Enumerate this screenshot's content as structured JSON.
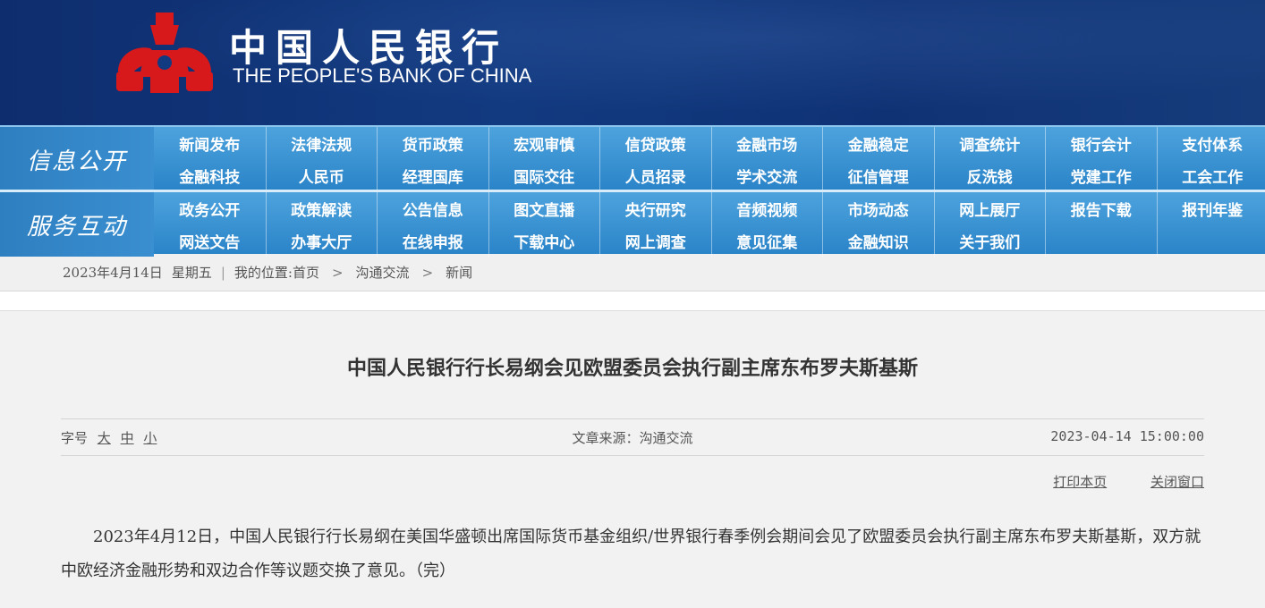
{
  "header": {
    "logo_cn": "中国人民银行",
    "logo_en": "THE PEOPLE'S BANK OF CHINA",
    "emblem_color": "#d7191c"
  },
  "nav": {
    "info": {
      "title": "信息公开",
      "items": [
        "新闻发布",
        "法律法规",
        "货币政策",
        "宏观审慎",
        "信贷政策",
        "金融市场",
        "金融稳定",
        "调查统计",
        "银行会计",
        "支付体系",
        "金融科技",
        "人民币",
        "经理国库",
        "国际交往",
        "人员招录",
        "学术交流",
        "征信管理",
        "反洗钱",
        "党建工作",
        "工会工作"
      ]
    },
    "service": {
      "title": "服务互动",
      "items": [
        "政务公开",
        "政策解读",
        "公告信息",
        "图文直播",
        "央行研究",
        "音频视频",
        "市场动态",
        "网上展厅",
        "报告下载",
        "报刊年鉴",
        "网送文告",
        "办事大厅",
        "在线申报",
        "下载中心",
        "网上调查",
        "意见征集",
        "金融知识",
        "关于我们"
      ]
    }
  },
  "breadcrumb": {
    "date": "2023年4月14日",
    "weekday": "星期五",
    "location_label": "我的位置:",
    "home": "首页",
    "level1": "沟通交流",
    "level2": "新闻",
    "arrow": ">"
  },
  "article": {
    "title": "中国人民银行行长易纲会见欧盟委员会执行副主席东布罗夫斯基斯",
    "font_size_label": "字号",
    "font_large": "大",
    "font_medium": "中",
    "font_small": "小",
    "source": "文章来源：沟通交流",
    "date": "2023-04-14 15:00:00",
    "print_label": "打印本页",
    "close_label": "关闭窗口",
    "body": "2023年4月12日，中国人民银行行长易纲在美国华盛顿出席国际货币基金组织/世界银行春季例会期间会见了欧盟委员会执行副主席东布罗夫斯基斯，双方就中欧经济金融形势和双边合作等议题交换了意见。（完）"
  }
}
